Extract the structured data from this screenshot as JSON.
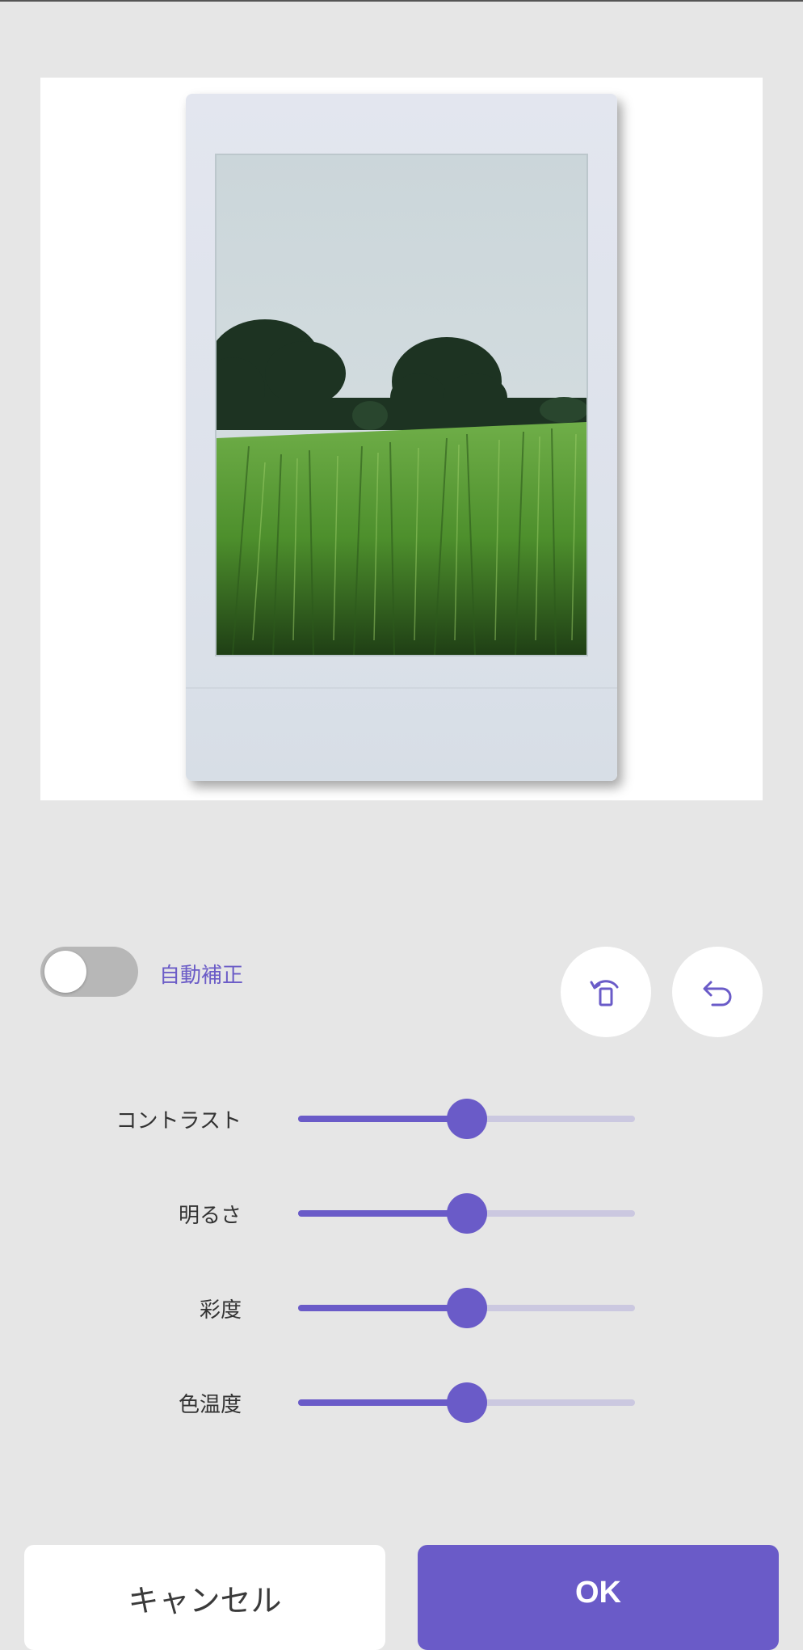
{
  "auto_correct": {
    "label": "自動補正",
    "enabled": false
  },
  "adjustments": [
    {
      "key": "contrast",
      "label": "コントラスト",
      "value": 0.5
    },
    {
      "key": "brightness",
      "label": "明るさ",
      "value": 0.5
    },
    {
      "key": "saturation",
      "label": "彩度",
      "value": 0.5
    },
    {
      "key": "color_temperature",
      "label": "色温度",
      "value": 0.5
    }
  ],
  "buttons": {
    "cancel": "キャンセル",
    "ok": "OK"
  },
  "icons": {
    "rotate": "rotate-device-icon",
    "undo": "undo-icon"
  },
  "colors": {
    "accent": "#6a5bc8",
    "track": "#cbc8e0",
    "background": "#e6e6e6"
  }
}
